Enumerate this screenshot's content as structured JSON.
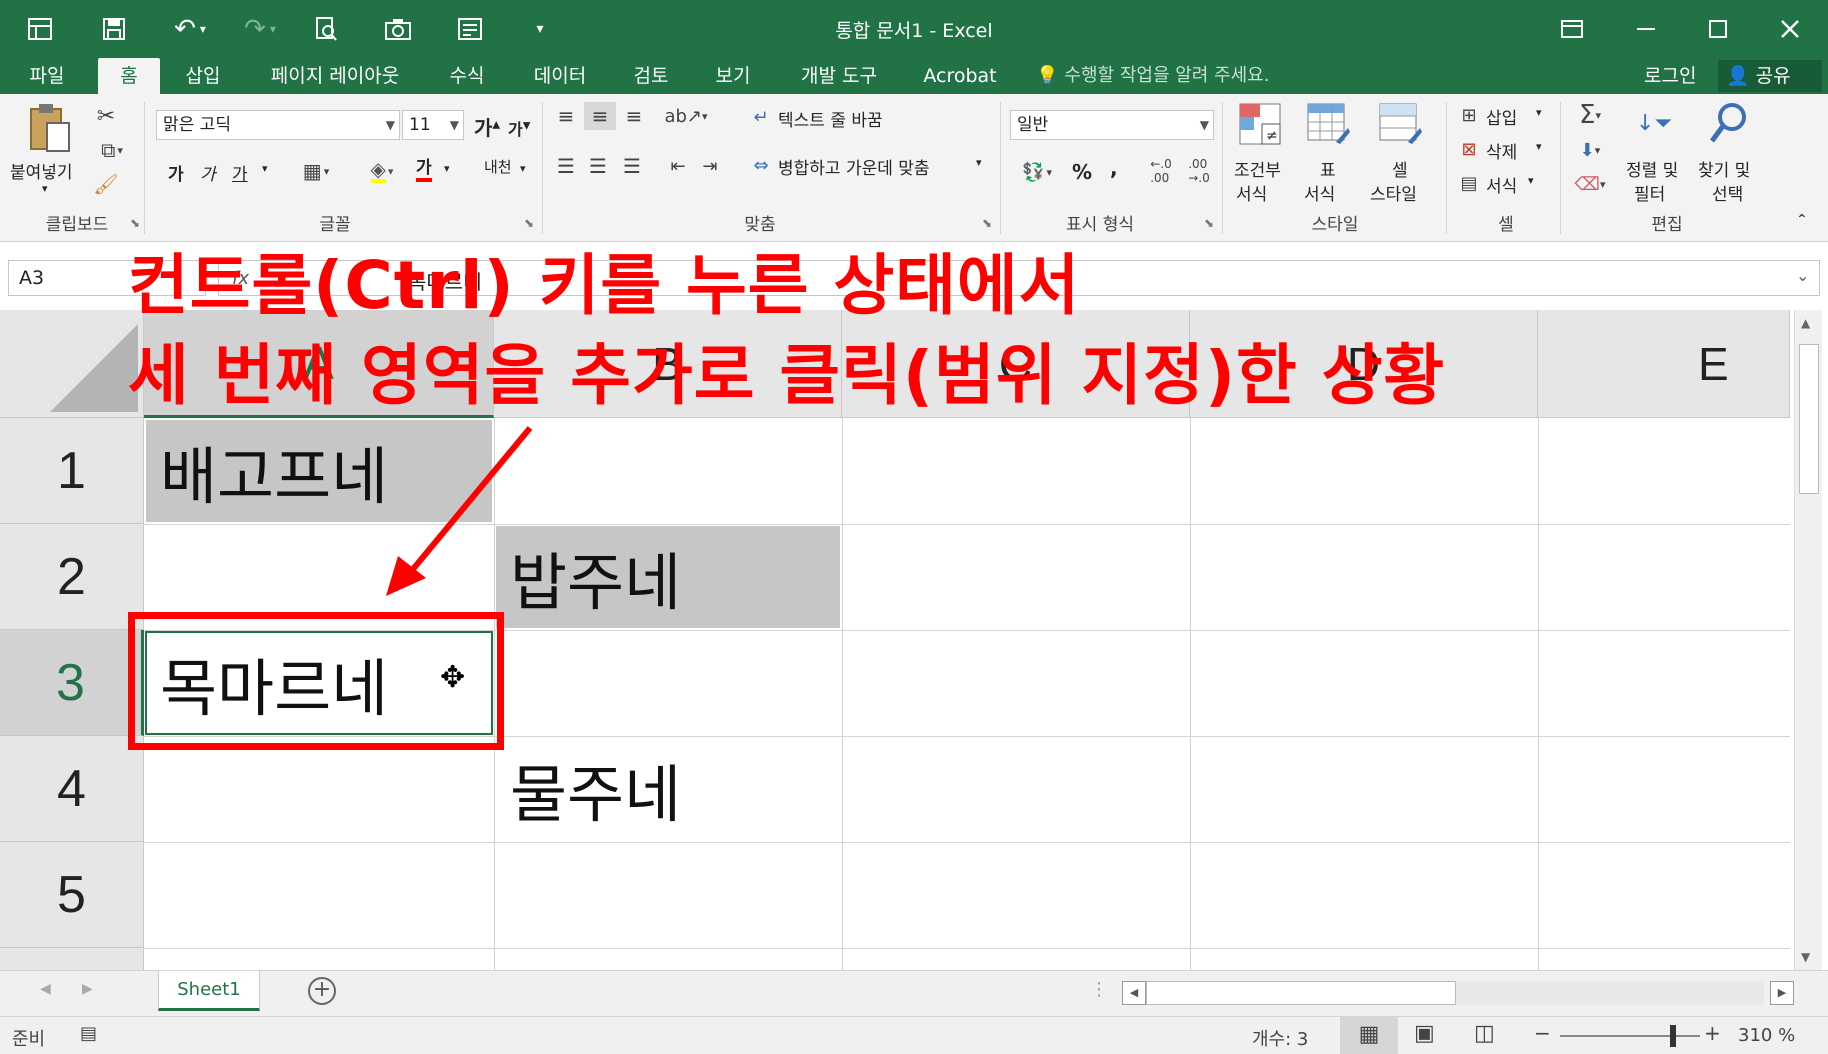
{
  "window": {
    "title": "통합 문서1 - Excel"
  },
  "tabs": [
    "파일",
    "홈",
    "삽입",
    "페이지 레이아웃",
    "수식",
    "데이터",
    "검토",
    "보기",
    "개발 도구",
    "Acrobat"
  ],
  "tell_me": "수행할 작업을 알려 주세요.",
  "account": {
    "login": "로그인",
    "share": "공유"
  },
  "ribbon": {
    "clipboard": {
      "paste": "붙여넣기",
      "label": "클립보드"
    },
    "font": {
      "name": "맑은 고딕",
      "size": "11",
      "bold": "가",
      "italic": "가",
      "underline": "가",
      "font_color": "가",
      "phonetic": "내천",
      "label": "글꼴"
    },
    "alignment": {
      "wrap_text": "텍스트 줄 바꿈",
      "merge_center": "병합하고 가운데 맞춤",
      "label": "맞춤"
    },
    "number": {
      "format": "일반",
      "percent": "%",
      "comma": ",",
      "label": "표시 형식"
    },
    "styles": {
      "conditional_1": "조건부",
      "conditional_2": "서식",
      "table_1": "표",
      "table_2": "서식",
      "cell_1": "셀",
      "cell_2": "스타일",
      "label": "스타일"
    },
    "cells": {
      "insert": "삽입",
      "delete": "삭제",
      "format": "서식",
      "label": "셀"
    },
    "editing": {
      "sort_1": "정렬 및",
      "sort_2": "필터",
      "find_1": "찾기 및",
      "find_2": "선택",
      "label": "편집"
    }
  },
  "formula_bar": {
    "name_box": "A3",
    "fx": "fx",
    "content": "목마르네"
  },
  "grid": {
    "columns": [
      "A",
      "B",
      "C",
      "D",
      "E"
    ],
    "rows": [
      "1",
      "2",
      "3",
      "4",
      "5"
    ],
    "cells": {
      "A1": "배고프네",
      "B2": "밥주네",
      "A3": "목마르네",
      "B4": "물주네"
    },
    "highlighted": [
      "A1",
      "B2"
    ],
    "active_cell": "A3"
  },
  "sheets": [
    "Sheet1"
  ],
  "status": {
    "ready": "준비",
    "count": "개수: 3",
    "zoom": "310 %"
  },
  "annotation": {
    "line1": "컨트롤(Ctrl) 키를 누른 상태에서",
    "line2": "세 번째 영역을 추가로 클릭(범위 지정)한 상황"
  },
  "colors": {
    "excel_green": "#217346",
    "annotation_red": "#ff0000",
    "selection_gray": "#c6c6c6"
  }
}
